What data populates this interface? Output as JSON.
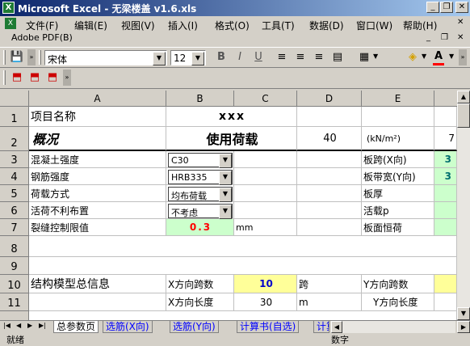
{
  "window": {
    "title": "Microsoft Excel - 无梁楼盖 v1.6.xls",
    "app_icon": "excel-icon"
  },
  "menu": {
    "items": [
      "文件(F)",
      "编辑(E)",
      "视图(V)",
      "插入(I)",
      "格式(O)",
      "工具(T)",
      "数据(D)",
      "窗口(W)",
      "帮助(H)"
    ],
    "adobe": "Adobe PDF(B)"
  },
  "toolbar": {
    "font_name": "宋体",
    "font_size": "12",
    "bold": "B",
    "italic": "I",
    "underline": "U",
    "font_color_glyph": "A"
  },
  "sheet": {
    "columns": [
      "A",
      "B",
      "C",
      "D",
      "E"
    ],
    "rows": [
      "1",
      "2",
      "3",
      "4",
      "5",
      "6",
      "7",
      "8",
      "9",
      "10",
      "11"
    ],
    "a1": "项目名称",
    "b1": "xxx",
    "a2": "概况",
    "b2": "使用荷载",
    "d2": "40",
    "e2": "(kN/m²)",
    "f2_partial": "7",
    "a3": "混凝土强度",
    "a4": "钢筋强度",
    "a5": "荷载方式",
    "a6": "活荷不利布置",
    "a7": "裂缝控制限值",
    "b3": "C30",
    "b4": "HRB335",
    "b5": "均布荷载",
    "b6": "不考虑",
    "b7": "0.3",
    "c7": "mm",
    "e3": "板跨(X向)",
    "e4": "板带宽(Y向)",
    "e5": "板厚",
    "e6": "活载p",
    "e7": "板面恒荷",
    "f3_partial": "3",
    "f4_partial": "3",
    "a10": "结构模型总信息",
    "b10": "X方向跨数",
    "c10": "10",
    "d10": "跨",
    "e10": "Y方向跨数",
    "b11": "X方向长度",
    "c11": "30",
    "d11": "m",
    "e11": "Y方向长度"
  },
  "tabs": [
    "总参数页",
    "选筋(X向)",
    "选筋(Y向)",
    "计算书(自选)",
    "计算"
  ],
  "status": {
    "left": "就绪",
    "right": "数字"
  },
  "colors": {
    "title_start": "#0a246a",
    "title_end": "#a6caf0",
    "green_cell": "#ccffcc",
    "yellow_cell": "#ffff99",
    "red_value": "#ff0000",
    "blue_value": "#0000cc"
  }
}
